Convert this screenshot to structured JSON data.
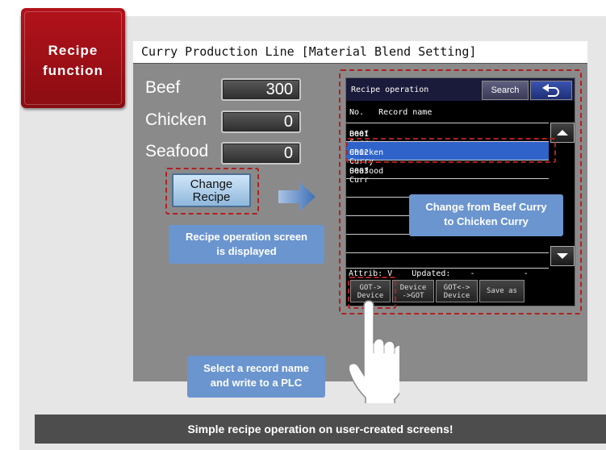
{
  "badge": {
    "text": "Recipe\nfunction"
  },
  "header": {
    "title": "Curry Production Line [Material Blend Setting]"
  },
  "fields": [
    {
      "label": "Beef",
      "value": "300"
    },
    {
      "label": "Chicken",
      "value": "0"
    },
    {
      "label": "Seafood",
      "value": "0"
    }
  ],
  "change_button": {
    "label": "Change\nRecipe"
  },
  "callouts": {
    "displayed": "Recipe operation screen\nis displayed",
    "change": "Change from Beef Curry\nto Chicken Curry",
    "select": "Select a record name\nand write to a PLC"
  },
  "recipe_panel": {
    "title": "Recipe operation",
    "search_label": "Search",
    "back_icon": "undo-arrow-icon",
    "col_no": "No.",
    "col_name": "Record name",
    "records": [
      {
        "no": "0001",
        "name": "Beef Curry"
      },
      {
        "no": "0002",
        "name": "Chicken Curry"
      },
      {
        "no": "0003",
        "name": "Seafood Curr"
      }
    ],
    "selected_index": 1,
    "attrib": "Attrib: V",
    "updated": "Updated:",
    "updated_dash1": "-",
    "updated_dash2": "-",
    "buttons": [
      "GOT->\nDevice",
      "Device\n->GOT",
      "GOT<->\nDevice",
      "Save as"
    ]
  },
  "footer": {
    "text": "Simple recipe operation on user-created screens!"
  },
  "colors": {
    "accent_red": "#b3121b",
    "callout_blue": "#6b95cf",
    "selection_blue": "#2f63c9"
  }
}
